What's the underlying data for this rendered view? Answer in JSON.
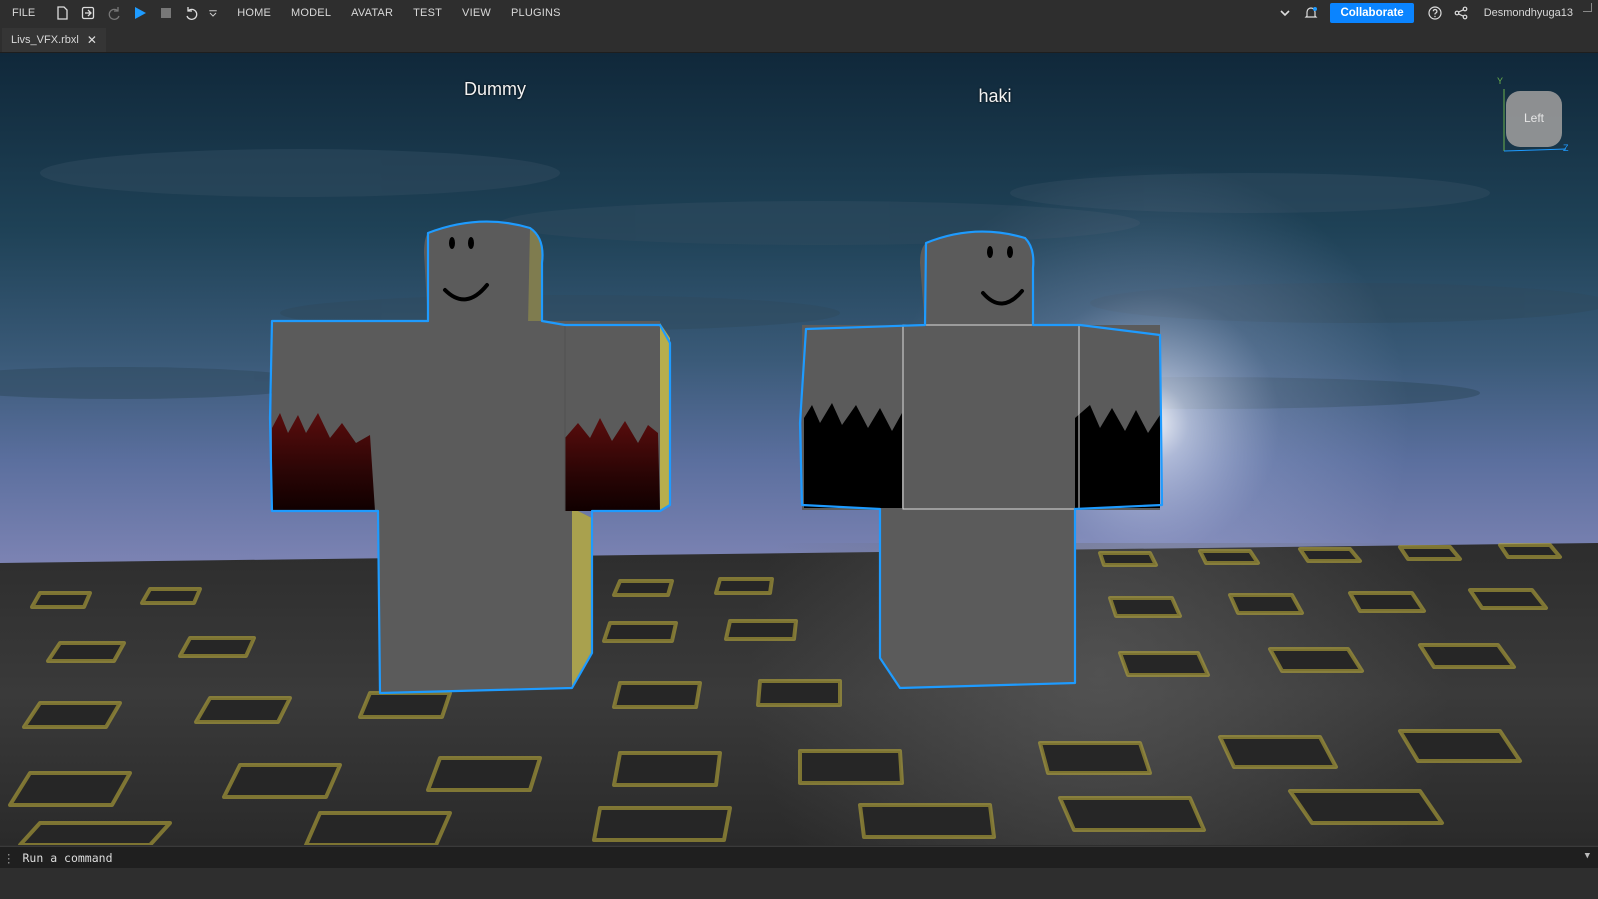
{
  "menubar": {
    "file": "FILE",
    "items": [
      "HOME",
      "MODEL",
      "AVATAR",
      "TEST",
      "VIEW",
      "PLUGINS"
    ],
    "collaborate": "Collaborate",
    "username": "Desmondhyuga13"
  },
  "tabs": [
    {
      "label": "Livs_VFX.rbxl"
    }
  ],
  "viewport": {
    "characters": [
      {
        "name": "Dummy"
      },
      {
        "name": "haki"
      }
    ],
    "viewcube_face": "Left",
    "axes": {
      "y": "Y",
      "z": "Z"
    }
  },
  "command_bar": {
    "placeholder": "Run a command"
  },
  "colors": {
    "accent": "#0a84ff",
    "selection": "#1e9bff",
    "body": "#5b5b5b"
  }
}
